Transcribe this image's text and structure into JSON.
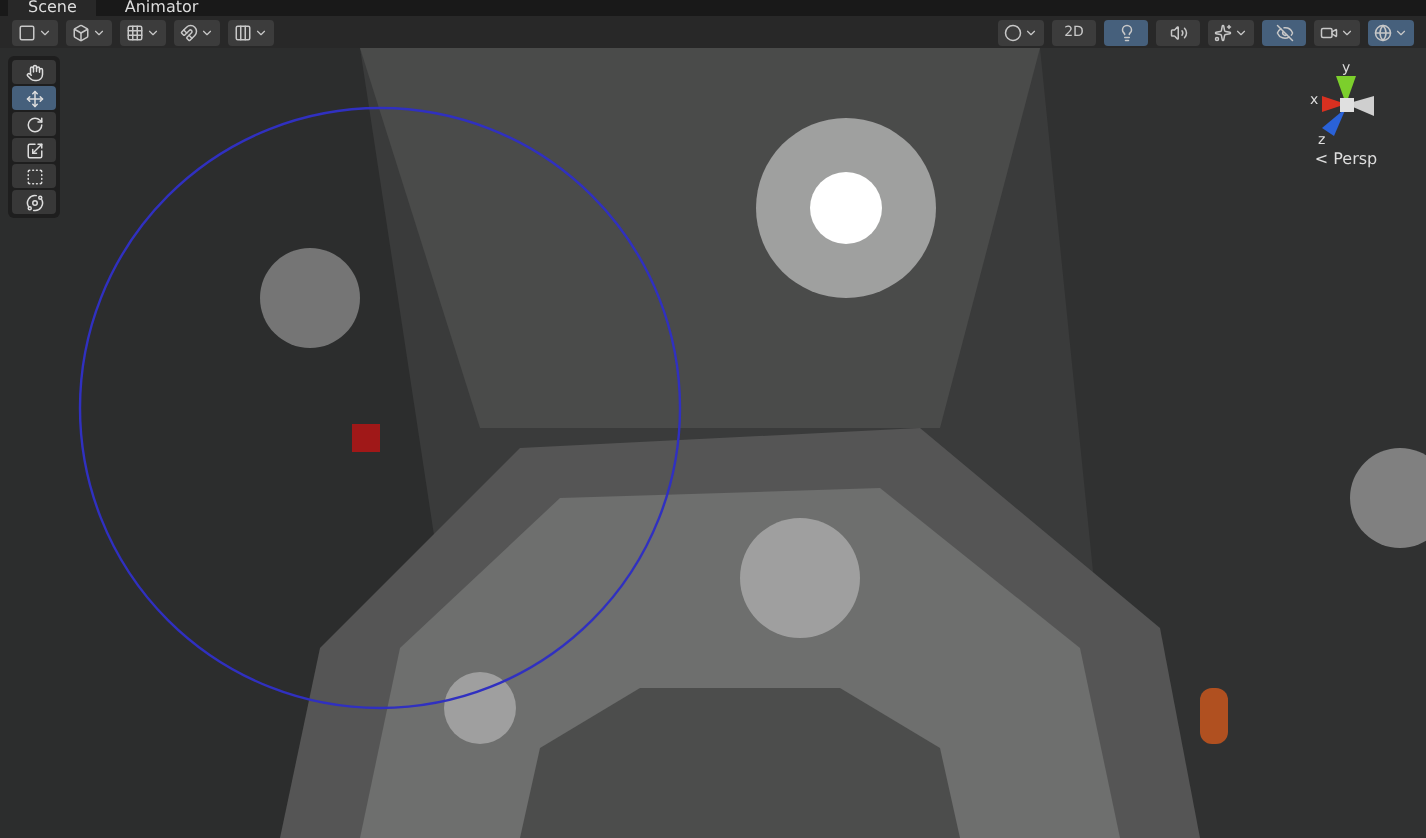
{
  "tabs": [
    {
      "label": "Scene",
      "selected": true
    },
    {
      "label": "Animator",
      "selected": false
    }
  ],
  "toolbar_left": [
    {
      "dropdown": true
    },
    {
      "dropdown": true
    },
    {
      "dropdown": true
    },
    {
      "dropdown": true
    },
    {
      "dropdown": true
    }
  ],
  "toolbar_right": [
    {
      "kind": "icon",
      "selected": false,
      "dropdown": true
    },
    {
      "kind": "text",
      "label": "2D",
      "selected": false,
      "dropdown": false
    },
    {
      "kind": "icon",
      "selected": true,
      "dropdown": false
    },
    {
      "kind": "icon",
      "selected": false,
      "dropdown": false
    },
    {
      "kind": "icon",
      "selected": false,
      "dropdown": true
    },
    {
      "kind": "icon",
      "selected": true,
      "dropdown": false
    },
    {
      "kind": "icon",
      "selected": false,
      "dropdown": true
    },
    {
      "kind": "icon",
      "selected": true,
      "dropdown": true
    }
  ],
  "tools": [
    {
      "selected": false
    },
    {
      "selected": true
    },
    {
      "selected": false
    },
    {
      "selected": false
    },
    {
      "selected": false
    },
    {
      "selected": false
    }
  ],
  "gizmo": {
    "axes": [
      "y",
      "x",
      "z"
    ],
    "projection": "< Persp"
  }
}
